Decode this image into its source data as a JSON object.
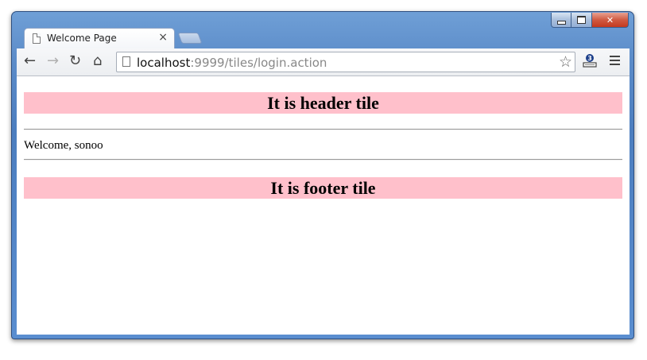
{
  "tab": {
    "title": "Welcome Page",
    "close": "×"
  },
  "toolbar": {
    "back_glyph": "←",
    "forward_glyph": "→",
    "reload_glyph": "↻",
    "home_glyph": "⌂",
    "url_host": "localhost",
    "url_rest": ":9999/tiles/login.action",
    "star_glyph": "☆"
  },
  "page": {
    "header_tile": "It is header tile",
    "welcome_text": "Welcome, sonoo",
    "footer_tile": "It is footer tile"
  },
  "colors": {
    "tile_background": "#ffc0cb",
    "window_frame": "#5c8cc9",
    "close_button": "#c4391f"
  },
  "icons": [
    "page-icon",
    "back-arrow-icon",
    "forward-arrow-icon",
    "reload-icon",
    "home-icon",
    "bookmark-star-icon",
    "extension-icon",
    "menu-icon",
    "minimize-icon",
    "maximize-icon",
    "close-icon"
  ]
}
